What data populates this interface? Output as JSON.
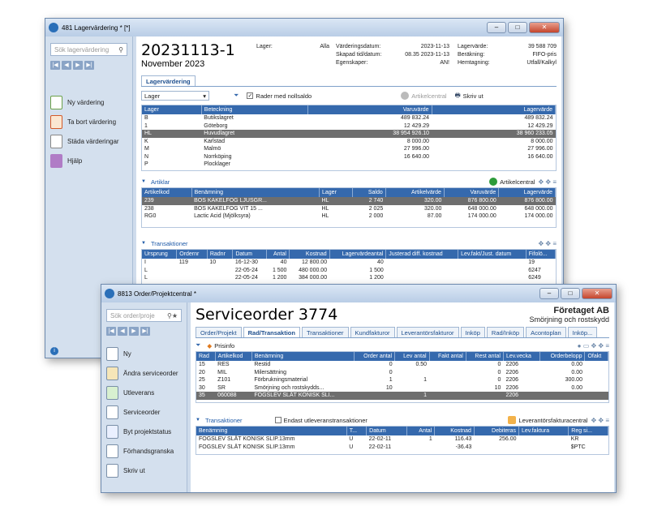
{
  "win1": {
    "title": "481 Lagervärdering * [*]",
    "search_placeholder": "Sök lagervärdering",
    "side": [
      "Ny värdering",
      "Ta bort värdering",
      "Städa värderingar",
      "Hjälp"
    ],
    "header": {
      "title": "20231113-1",
      "subtitle": "November 2023"
    },
    "info1": [
      [
        "Lager:",
        "Alla"
      ]
    ],
    "info2": [
      [
        "Värderingsdatum:",
        "2023-11-13"
      ],
      [
        "Skapad tid/datum:",
        "08.35 2023-11-13"
      ],
      [
        "Egenskaper:",
        "AN!"
      ]
    ],
    "info3": [
      [
        "Lagervärde:",
        "39 588 709"
      ],
      [
        "Beräkning:",
        "FIFO-pris"
      ],
      [
        "Hemtagning:",
        "Utfall/Kalkyl"
      ]
    ],
    "tab": "Lagervärdering",
    "filter": "Lager",
    "zero_label": "Rader med nollsaldo",
    "artcentral_disabled": "Artikelcentral",
    "print": "Skriv ut",
    "lager": {
      "headers": [
        "Lager",
        "Beteckning",
        "Varuvärde",
        "Lagervärde"
      ],
      "rows": [
        [
          "B",
          "Butikslagret",
          "489 832.24",
          "489 832.24"
        ],
        [
          "1",
          "Göteborg",
          "12 429.29",
          "12 429.29"
        ],
        [
          "HL",
          "Huvudlagret",
          "38 954 926.10",
          "38 960 233.05"
        ],
        [
          "K",
          "Karlstad",
          "8 000.00",
          "8 000.00"
        ],
        [
          "M",
          "Malmö",
          "27 996.00",
          "27 996.00"
        ],
        [
          "N",
          "Norrköping",
          "16 640.00",
          "16 640.00"
        ],
        [
          "P",
          "Plocklager",
          "",
          ""
        ]
      ]
    },
    "art_title": "Artiklar",
    "art_central": "Artikelcentral",
    "art": {
      "headers": [
        "Artikelkod",
        "Benämning",
        "Lager",
        "Saldo",
        "Artikelvärde",
        "Varuvärde",
        "Lagervärde"
      ],
      "rows": [
        [
          "239",
          "BOS KAKELFOG LJUSGR...",
          "HL",
          "2 740",
          "320.00",
          "876 800.00",
          "876 800.00"
        ],
        [
          "238",
          "BOS KAKELFOG VIT 15 ...",
          "HL",
          "2 025",
          "320.00",
          "648 000.00",
          "648 000.00"
        ],
        [
          "RG0",
          "Lactic Acid (Mjölksyra)",
          "HL",
          "2 000",
          "87.00",
          "174 000.00",
          "174 000.00"
        ]
      ]
    },
    "trans_title": "Transaktioner",
    "trans": {
      "headers": [
        "Ursprung",
        "Ordernr",
        "Radnr",
        "Datum",
        "Antal",
        "Kostnad",
        "Lagervärdeantal",
        "Justerad diff. kostnad",
        "Lev.fakt/Just. datum",
        "Fifolö..."
      ],
      "rows": [
        [
          "I",
          "119",
          "10",
          "16-12-30",
          "40",
          "12 800.00",
          "40",
          "",
          "",
          "19"
        ],
        [
          "L",
          "",
          "",
          "22-05-24",
          "1 500",
          "480 000.00",
          "1 500",
          "",
          "",
          "6247"
        ],
        [
          "L",
          "",
          "",
          "22-05-24",
          "1 200",
          "384 000.00",
          "1 200",
          "",
          "",
          "6249"
        ]
      ]
    }
  },
  "win2": {
    "title": "8813 Order/Projektcentral *",
    "search_placeholder": "Sök order/proje",
    "side": [
      "Ny",
      "Ändra serviceorder",
      "Utleverans",
      "Serviceorder",
      "Byt projektstatus",
      "Förhandsgranska",
      "Skriv ut"
    ],
    "header": {
      "title": "Serviceorder 3774",
      "company": "Företaget AB",
      "desc": "Smörjning och rostskydd"
    },
    "tabs": [
      "Order/Projekt",
      "Rad/Transaktion",
      "Transaktioner",
      "Kundfakturor",
      "Leverantörsfakturor",
      "Inköp",
      "Rad/Inköp",
      "Acontoplan",
      "Inköp..."
    ],
    "prisinfo": "Prisinfo",
    "rad": {
      "headers": [
        "Rad",
        "Artikelkod",
        "Benämning",
        "Order antal",
        "Lev antal",
        "Fakt antal",
        "Rest antal",
        "Lev.vecka",
        "Orderbelopp",
        "Ofakt"
      ],
      "rows": [
        [
          "15",
          "RES",
          "Restid",
          "0",
          "0.50",
          "",
          "0",
          "2206",
          "0.00",
          ""
        ],
        [
          "20",
          "MIL",
          "Milersättning",
          "0",
          "",
          "",
          "0",
          "2206",
          "0.00",
          ""
        ],
        [
          "25",
          "Z101",
          "Förbrukningsmaterial",
          "1",
          "1",
          "",
          "0",
          "2206",
          "300.00",
          ""
        ],
        [
          "30",
          "SR",
          "Smörjning och rostskydds...",
          "10",
          "",
          "",
          "10",
          "2206",
          "0.00",
          ""
        ],
        [
          "35",
          "060088",
          "FOGSLEV SLÄT KONISK SLI...",
          "",
          "1",
          "",
          "",
          "2206",
          "",
          ""
        ]
      ]
    },
    "trans_title": "Transaktioner",
    "only_label": "Endast utleveranstransaktioner",
    "lev_central": "Leverantörsfakturacentral",
    "trans": {
      "headers": [
        "Benämning",
        "T...",
        "Datum",
        "Antal",
        "Kostnad",
        "Debiteras",
        "Lev.faktura",
        "Reg si..."
      ],
      "rows": [
        [
          "FOGSLEV SLÄT KONISK SLIP.13mm",
          "U",
          "22-02-11",
          "1",
          "116.43",
          "256.00",
          "",
          "KR"
        ],
        [
          "FOGSLEV SLÄT KONISK SLIP.13mm",
          "U",
          "22-02-11",
          "",
          "-36.43",
          "",
          "",
          "$PTC"
        ]
      ]
    }
  }
}
